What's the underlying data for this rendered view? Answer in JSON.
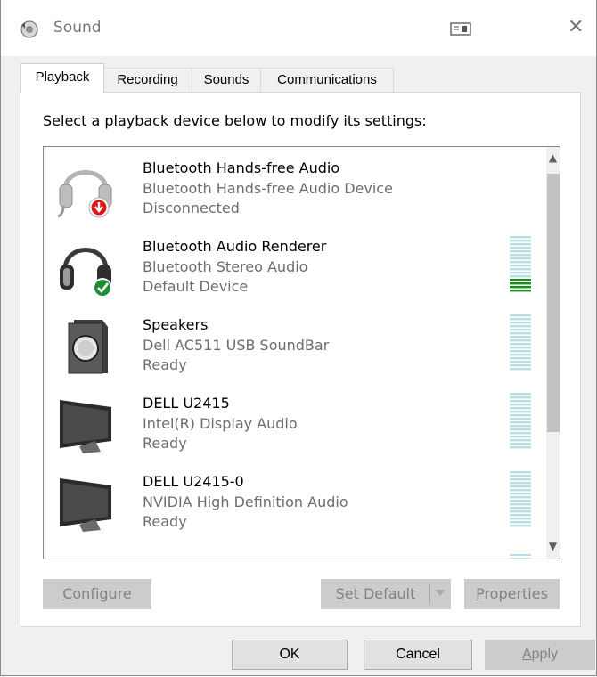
{
  "window": {
    "title": "Sound",
    "close_glyph": "✕"
  },
  "tabs": [
    {
      "label": "Playback",
      "active": true
    },
    {
      "label": "Recording",
      "active": false
    },
    {
      "label": "Sounds",
      "active": false
    },
    {
      "label": "Communications",
      "active": false
    }
  ],
  "instruction": "Select a playback device below to modify its settings:",
  "devices": [
    {
      "name": "Bluetooth Hands-free Audio",
      "description": "Bluetooth Hands-free Audio Device",
      "status": "Disconnected",
      "icon": "headset-disconnected-icon",
      "meter_level": null
    },
    {
      "name": "Bluetooth Audio Renderer",
      "description": "Bluetooth Stereo Audio",
      "status": "Default Device",
      "icon": "headphones-default-icon",
      "meter_level": 0.25
    },
    {
      "name": "Speakers",
      "description": "Dell AC511 USB SoundBar",
      "status": "Ready",
      "icon": "speaker-icon",
      "meter_level": 0
    },
    {
      "name": "DELL U2415",
      "description": "Intel(R) Display Audio",
      "status": "Ready",
      "icon": "monitor-icon",
      "meter_level": 0
    },
    {
      "name": "DELL U2415-0",
      "description": "NVIDIA High Definition Audio",
      "status": "Ready",
      "icon": "monitor-icon",
      "meter_level": 0
    }
  ],
  "buttons": {
    "configure": {
      "prefix": "",
      "accel": "C",
      "rest": "onfigure"
    },
    "set_default": {
      "prefix": "",
      "accel": "S",
      "rest": "et Default"
    },
    "properties": {
      "prefix": "",
      "accel": "P",
      "rest": "roperties"
    },
    "ok": "OK",
    "cancel": "Cancel",
    "apply": {
      "prefix": "",
      "accel": "A",
      "rest": "pply"
    }
  },
  "colors": {
    "meter_active": "#1a8f1a",
    "meter_idle": "#b8dfe4",
    "default_check": "#1e8e34",
    "disconnected_badge": "#e01818"
  }
}
